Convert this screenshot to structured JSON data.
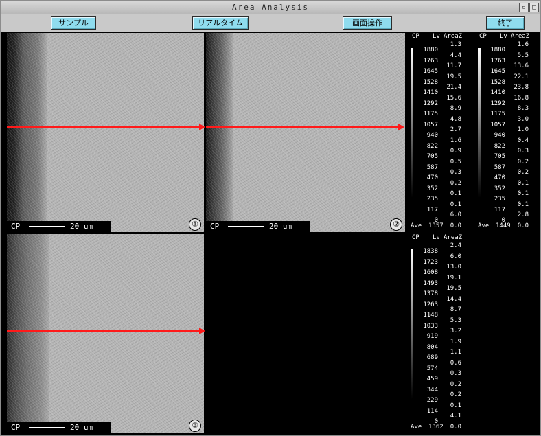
{
  "window": {
    "title": "Area  Analysis",
    "controls": [
      "▫",
      "□"
    ]
  },
  "toolbar": {
    "sample_label": "サンプル",
    "realtime_label": "リアルタイム",
    "screen_label": "画面操作",
    "exit_label": "終了"
  },
  "panels": [
    {
      "cp": "CP",
      "scale": "20 um",
      "num": "①"
    },
    {
      "cp": "CP",
      "scale": "20 um",
      "num": "②"
    },
    {
      "cp": "CP",
      "scale": "20 um",
      "num": "③"
    }
  ],
  "legends": [
    {
      "headers": {
        "cp": "CP",
        "lv": "Lv",
        "area": "AreaZ"
      },
      "lv": [
        "1880",
        "1763",
        "1645",
        "1528",
        "1410",
        "1292",
        "1175",
        "1057",
        "940",
        "822",
        "705",
        "587",
        "470",
        "352",
        "235",
        "117",
        "0"
      ],
      "area": [
        "1.3",
        "4.4",
        "11.7",
        "19.5",
        "21.4",
        "15.6",
        "8.9",
        "4.8",
        "2.7",
        "1.6",
        "0.9",
        "0.5",
        "0.3",
        "0.2",
        "0.1",
        "0.1",
        "6.0",
        "0.0"
      ],
      "ave_label": "Ave",
      "ave_value": "1357"
    },
    {
      "headers": {
        "cp": "CP",
        "lv": "Lv",
        "area": "AreaZ"
      },
      "lv": [
        "1880",
        "1763",
        "1645",
        "1528",
        "1410",
        "1292",
        "1175",
        "1057",
        "940",
        "822",
        "705",
        "587",
        "470",
        "352",
        "235",
        "117",
        "0"
      ],
      "area": [
        "1.6",
        "5.5",
        "13.6",
        "22.1",
        "23.8",
        "16.8",
        "8.3",
        "3.0",
        "1.0",
        "0.4",
        "0.3",
        "0.2",
        "0.2",
        "0.1",
        "0.1",
        "0.1",
        "2.8",
        "0.0"
      ],
      "ave_label": "Ave",
      "ave_value": "1449"
    },
    {
      "headers": {
        "cp": "CP",
        "lv": "Lv",
        "area": "AreaZ"
      },
      "lv": [
        "1838",
        "1723",
        "1608",
        "1493",
        "1378",
        "1263",
        "1148",
        "1033",
        "919",
        "804",
        "689",
        "574",
        "459",
        "344",
        "229",
        "114",
        "0"
      ],
      "area": [
        "2.4",
        "6.0",
        "13.0",
        "19.1",
        "19.5",
        "14.4",
        "8.7",
        "5.3",
        "3.2",
        "1.9",
        "1.1",
        "0.6",
        "0.3",
        "0.2",
        "0.2",
        "0.1",
        "4.1",
        "0.0"
      ],
      "ave_label": "Ave",
      "ave_value": "1362"
    }
  ],
  "colors": {
    "arrow": "#ff1a1a",
    "button": "#8fdcee",
    "background": "#000000"
  }
}
